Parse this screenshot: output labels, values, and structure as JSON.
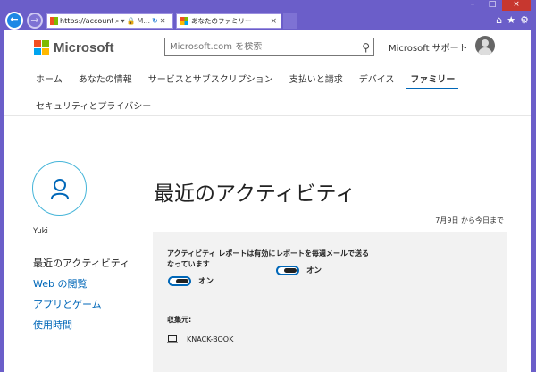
{
  "browser": {
    "address_url": "https://account.m",
    "tab1_title": "M...",
    "tab2_title": "あなたのファミリー",
    "close_glyph": "×"
  },
  "header": {
    "brand": "Microsoft",
    "search_placeholder": "Microsoft.com を検索",
    "support": "Microsoft サポート"
  },
  "nav": {
    "row1": [
      "ホーム",
      "あなたの情報",
      "サービスとサブスクリプション",
      "支払いと請求",
      "デバイス",
      "ファミリー"
    ],
    "row2": [
      "セキュリティとプライバシー"
    ],
    "active_index": 5
  },
  "profile": {
    "name": "Yuki"
  },
  "sidebar": {
    "items": [
      "最近のアクティビティ",
      "Web の閲覧",
      "アプリとゲーム",
      "使用時間"
    ]
  },
  "main": {
    "title": "最近のアクティビティ",
    "date_range": "7月9日 から今日まで",
    "setting1_label_line1": "アクティビティ レポートは有効に",
    "setting1_label_line2": "なっています",
    "setting1_state": "オン",
    "setting2_label": "レポートを毎週メールで送る",
    "setting2_state": "オン",
    "collected_from": "収集元:",
    "device_name": "KNACK-BOOK"
  },
  "colors": {
    "accent": "#0067b8",
    "chrome": "#6b5ec9",
    "panel": "#f2f2f2"
  }
}
